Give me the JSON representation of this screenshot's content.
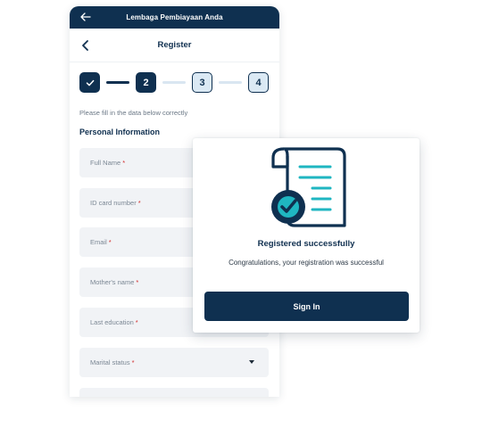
{
  "app": {
    "topbar_title": "Lembaga Pembiayaan Anda",
    "page_title": "Register"
  },
  "stepper": {
    "steps": [
      "✓",
      "2",
      "3",
      "4"
    ],
    "current": 2
  },
  "form": {
    "hint": "Please fill in the data below correctly",
    "section_title": "Personal Information",
    "fields": [
      {
        "label": "Full Name",
        "required_mark": "*"
      },
      {
        "label": "ID card number",
        "required_mark": "*"
      },
      {
        "label": "Email",
        "required_mark": "*"
      },
      {
        "label": "Mother's name",
        "required_mark": "*"
      },
      {
        "label": "Last education",
        "required_mark": "*"
      },
      {
        "label": "Marital status",
        "required_mark": "*"
      }
    ]
  },
  "modal": {
    "title": "Registered successfully",
    "message": "Congratulations, your registration was successful",
    "button_label": "Sign In"
  },
  "colors": {
    "primary": "#0f3050",
    "accent": "#1fb6c1",
    "field_bg": "#f1f3f6",
    "required": "#d22a2a"
  }
}
